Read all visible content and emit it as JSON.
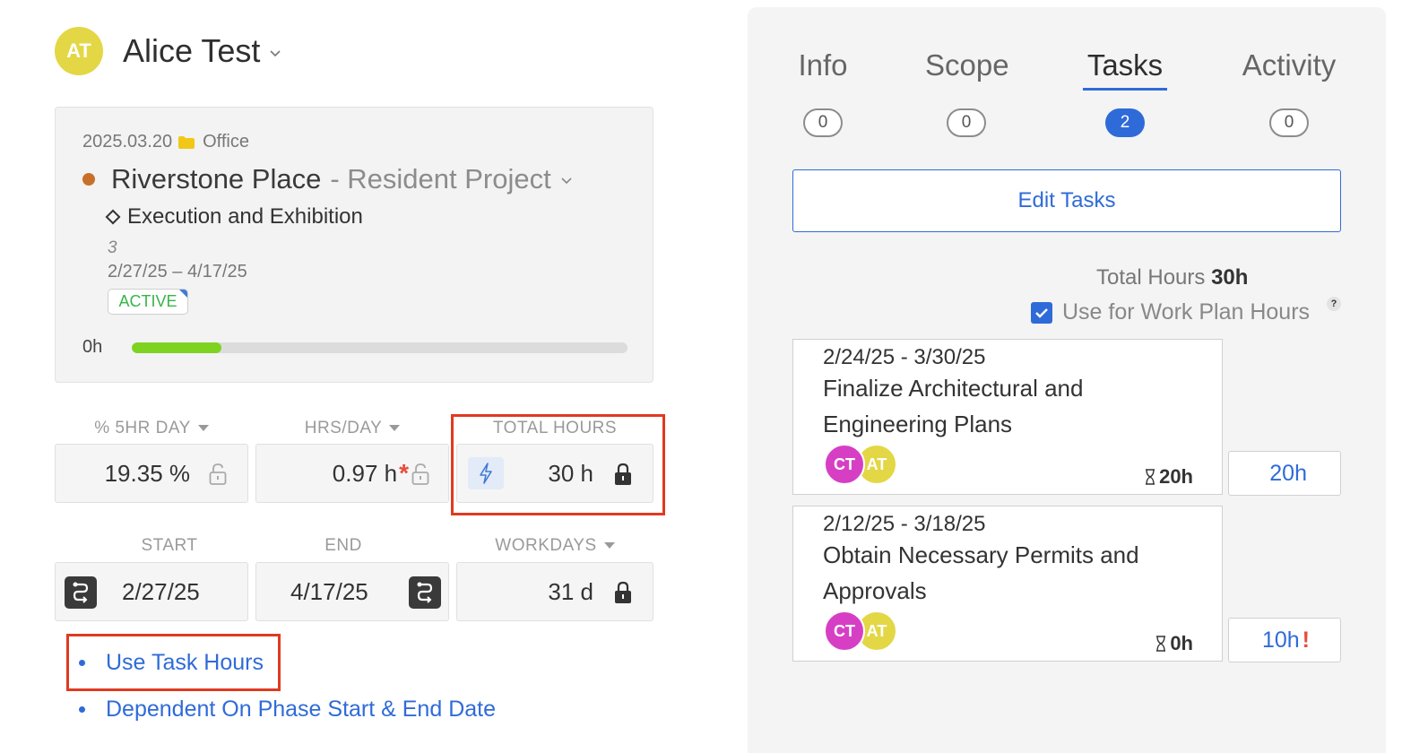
{
  "user": {
    "initials": "AT",
    "name": "Alice Test"
  },
  "project": {
    "date": "2025.03.20",
    "folder": "Office",
    "name": "Riverstone Place",
    "subtitle": "- Resident Project",
    "phase": "Execution and Exhibition",
    "phase_number": "3",
    "phase_dates": "2/27/25 – 4/17/25",
    "status": "ACTIVE",
    "progress_label": "0h",
    "progress_fraction": 0.18
  },
  "fields": {
    "pct_label": "% 5HR DAY",
    "pct_value": "19.35 %",
    "hrs_label": "HRS/DAY",
    "hrs_value": "0.97 h",
    "hrs_required": "*",
    "total_label": "TOTAL HOURS",
    "total_value": "30 h",
    "start_label": "START",
    "start_value": "2/27/25",
    "end_label": "END",
    "end_value": "4/17/25",
    "workdays_label": "WORKDAYS",
    "workdays_value": "31 d"
  },
  "links": [
    {
      "label": "Use Task Hours"
    },
    {
      "label": "Dependent On Phase Start & End Date"
    }
  ],
  "tabs": [
    {
      "label": "Info",
      "count": "0"
    },
    {
      "label": "Scope",
      "count": "0"
    },
    {
      "label": "Tasks",
      "count": "2"
    },
    {
      "label": "Activity",
      "count": "0"
    }
  ],
  "active_tab": "Tasks",
  "edit_tasks_label": "Edit Tasks",
  "total_hours": {
    "label": "Total Hours",
    "value": "30h"
  },
  "use_work_plan": {
    "label": "Use for Work Plan Hours",
    "checked": true,
    "help": "?"
  },
  "tasks": [
    {
      "dates": "2/24/25 - 3/30/25",
      "name": "Finalize Architectural and Engineering Plans",
      "assignees": [
        "CT",
        "AT"
      ],
      "estimate": "20h",
      "hours": "20h",
      "warning": ""
    },
    {
      "dates": "2/12/25 - 3/18/25",
      "name": "Obtain Necessary Permits and Approvals",
      "assignees": [
        "CT",
        "AT"
      ],
      "estimate": "0h",
      "hours": "10h",
      "warning": "!"
    }
  ],
  "colors": {
    "accent": "#2f6bd8",
    "highlight": "#e03a21",
    "progress": "#7ed321",
    "active_badge": "#39b54a",
    "project_dot": "#c8702a",
    "avatar_at": "#e3d745",
    "avatar_ct": "#d63fc4"
  },
  "icons": {
    "user_chevron": "chevron-down-icon",
    "folder": "folder-icon",
    "phase": "diamond-icon",
    "lock": "lock-icon",
    "bolt": "lightning-icon",
    "dependency": "dependency-link-icon",
    "checkbox": "checkmark-icon",
    "estimate": "hourglass-icon"
  }
}
